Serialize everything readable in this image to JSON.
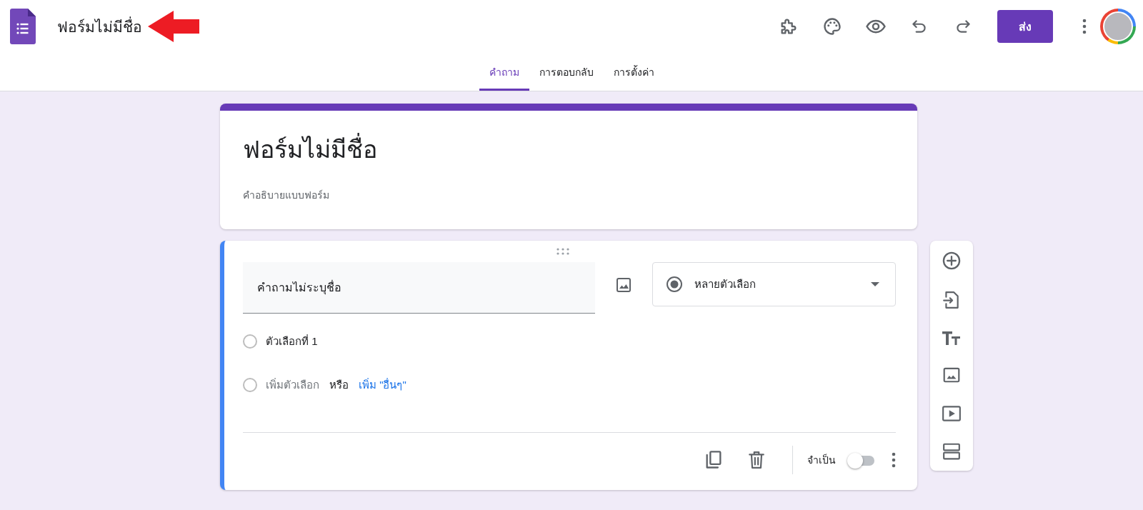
{
  "app": {
    "title": "ฟอร์มไม่มีชื่อ",
    "send_button": "ส่ง"
  },
  "tabs": [
    {
      "label": "คำถาม",
      "selected": true
    },
    {
      "label": "การตอบกลับ",
      "selected": false
    },
    {
      "label": "การตั้งค่า",
      "selected": false
    }
  ],
  "form": {
    "title": "ฟอร์มไม่มีชื่อ",
    "description": {
      "placeholder": "คำอธิบายแบบฟอร์ม"
    }
  },
  "question": {
    "title": "คำถามไม่ระบุชื่อ",
    "type": "หลายตัวเลือก",
    "options": [
      {
        "label": "ตัวเลือกที่ 1",
        "selected": false
      }
    ],
    "add_option": {
      "label": "เพิ่มตัวเลือก",
      "selected": false
    },
    "or": "หรือ",
    "add_other": "เพิ่ม \"อื่นๆ\"",
    "required_label": "จำเป็น",
    "required": false
  }
}
